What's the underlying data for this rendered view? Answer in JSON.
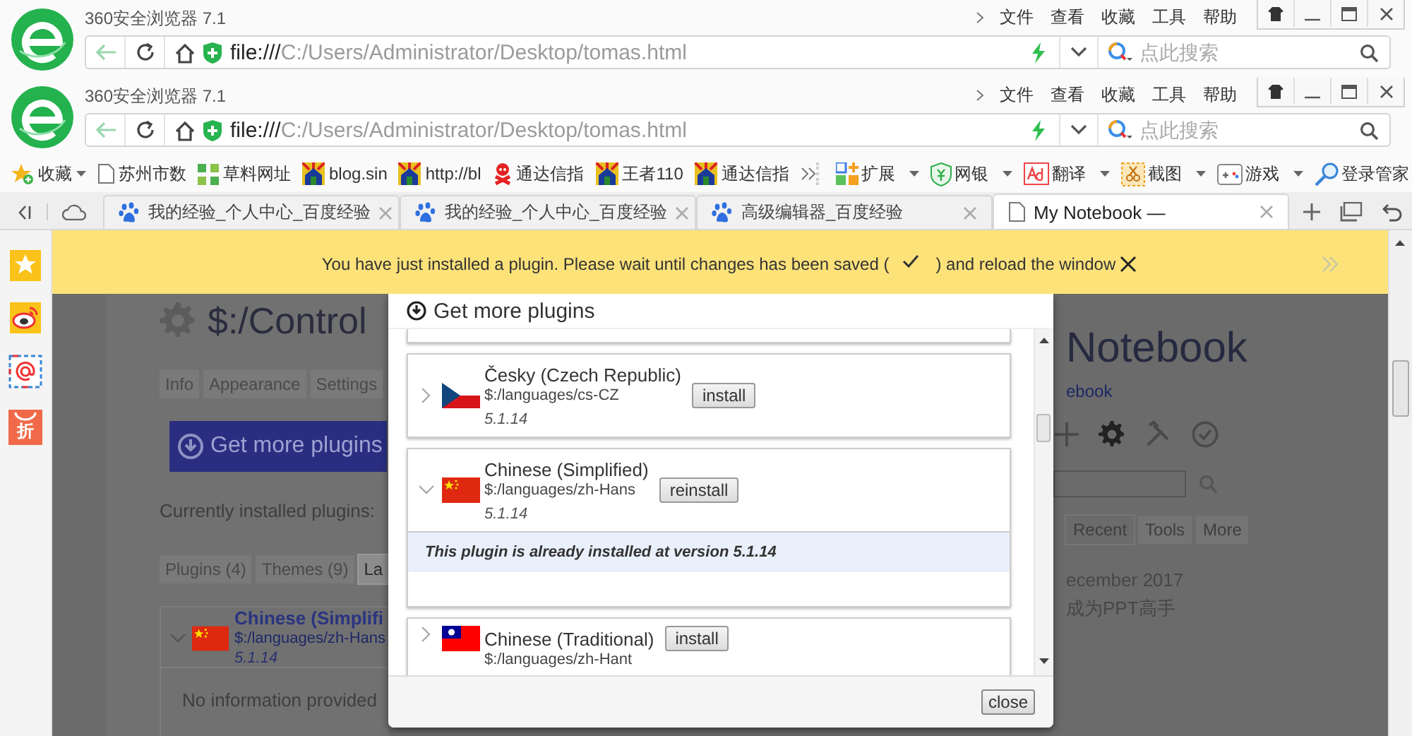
{
  "title_bars": [
    {
      "title": "360安全浏览器 7.1",
      "menu": [
        "文件",
        "查看",
        "收藏",
        "工具",
        "帮助"
      ],
      "address": "**file:///**C:/Users/Administrator/Desktop/tomas.html",
      "search": {
        "placeholder": "点此搜索"
      }
    },
    {
      "title": "360安全浏览器 7.1",
      "menu": [
        "文件",
        "查看",
        "收藏",
        "工具",
        "帮助"
      ],
      "address": "**file:///**C:/Users/Administrator/Desktop/tomas.html",
      "search": {
        "placeholder": "点此搜索"
      }
    }
  ],
  "bookmarks": {
    "items": [
      {
        "kind": "favorites",
        "label": "收藏",
        "menu": true
      },
      {
        "kind": "page",
        "label": "苏州市数",
        "menu": false
      },
      {
        "kind": "grid",
        "label": "草料网址",
        "menu": false
      },
      {
        "kind": "house",
        "label": "blog.sin",
        "menu": false
      },
      {
        "kind": "house",
        "label": "http://bl",
        "menu": false
      },
      {
        "kind": "figure",
        "label": "通达信指",
        "menu": false
      },
      {
        "kind": "house",
        "label": "王者110",
        "menu": false
      },
      {
        "kind": "house",
        "label": "通达信指",
        "menu": false
      }
    ],
    "tools": [
      {
        "kind": "apps",
        "label": "扩展",
        "menu": true
      },
      {
        "kind": "shield",
        "label": "网银",
        "menu": true
      },
      {
        "kind": "translate",
        "label": "翻译",
        "menu": true
      },
      {
        "kind": "screenshot",
        "label": "截图",
        "menu": true
      },
      {
        "kind": "game",
        "label": "游戏",
        "menu": true
      },
      {
        "kind": "login",
        "label": "登录管家",
        "menu": false
      }
    ]
  },
  "tabs": [
    {
      "kind": "paw",
      "title": "我的经验_个人中心_百度经验",
      "selected": false
    },
    {
      "kind": "paw",
      "title": "我的经验_个人中心_百度经验",
      "selected": false
    },
    {
      "kind": "paw",
      "title": "高级编辑器_百度经验",
      "selected": false
    },
    {
      "kind": "page",
      "title": "My Notebook —",
      "selected": true
    }
  ],
  "sidebar": [
    {
      "kind": "star"
    },
    {
      "kind": "weibo"
    },
    {
      "kind": "mail"
    },
    {
      "kind": "discount",
      "label": "折"
    }
  ],
  "notice": {
    "before": "You have just installed a plugin. Please wait until changes has been saved (",
    "after": ") and reload the window"
  },
  "control_panel": {
    "heading": "$:/Control",
    "tabs": [
      {
        "label": "Info",
        "selected": false
      },
      {
        "label": "Appearance",
        "selected": false
      },
      {
        "label": "Settings",
        "selected": false
      }
    ],
    "button": "Get more plugins",
    "installed_label": "Currently installed plugins:",
    "subtabs": [
      {
        "label": "Plugins (4)",
        "selected": false
      },
      {
        "label": "Themes (9)",
        "selected": false
      },
      {
        "label": "La",
        "selected": true
      }
    ],
    "plugin": {
      "name": "Chinese (Simplifi",
      "path": "$:/languages/zh-Hans",
      "version": "5.1.14",
      "info": "No information provided"
    }
  },
  "notebook": {
    "title": "Notebook",
    "link": "ebook",
    "tabs": [
      {
        "label": "Recent",
        "selected": true
      },
      {
        "label": "Tools",
        "selected": false
      },
      {
        "label": "More",
        "selected": false
      }
    ],
    "entries": [
      "ecember 2017",
      "成为PPT高手"
    ]
  },
  "dialog": {
    "header": "Get more plugins",
    "plugins": [
      {
        "kind": "cz",
        "name": "Česky (Czech Republic)",
        "path": "$:/languages/cs-CZ",
        "version": "5.1.14",
        "action": "install",
        "expanded": false
      },
      {
        "kind": "cn",
        "name": "Chinese (Simplified)",
        "path": "$:/languages/zh-Hans",
        "version": "5.1.14",
        "action": "reinstall",
        "expanded": true,
        "note": "This plugin is already installed at version 5.1.14"
      },
      {
        "kind": "tw",
        "name": "Chinese (Traditional)",
        "path": "$:/languages/zh-Hant",
        "action": "install",
        "expanded": false
      }
    ],
    "close": "close"
  }
}
